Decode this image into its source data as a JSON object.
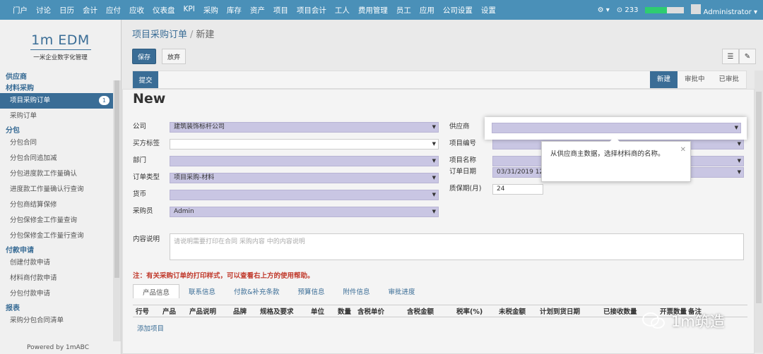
{
  "topnav": [
    "门户",
    "讨论",
    "日历",
    "会计",
    "应付",
    "应收",
    "仪表盘",
    "KPI",
    "采购",
    "库存",
    "资产",
    "项目",
    "项目会计",
    "工人",
    "费用管理",
    "员工",
    "应用",
    "公司设置",
    "设置"
  ],
  "topright": {
    "gear": "⚙ ▾",
    "notif": "233",
    "user": "Administrator ▾",
    "progress": 0.55
  },
  "logo": {
    "name": "1m EDM",
    "tagline": "一米企业数字化管理"
  },
  "sidebar": {
    "sections": [
      {
        "title": "供应商",
        "items": []
      },
      {
        "title": "材料采购",
        "items": [
          {
            "label": "项目采购订单",
            "badge": "1",
            "active": true
          },
          {
            "label": "采购订单"
          }
        ]
      },
      {
        "title": "分包",
        "items": [
          {
            "label": "分包合同"
          },
          {
            "label": "分包合同追加减"
          },
          {
            "label": "分包进度款工作量确认"
          },
          {
            "label": "进度款工作量确认行查询"
          },
          {
            "label": "分包商结算保修"
          },
          {
            "label": "分包保修金工作量查询"
          },
          {
            "label": "分包保修金工作量行查询"
          }
        ]
      },
      {
        "title": "付款申请",
        "items": [
          {
            "label": "创建付款申请"
          },
          {
            "label": "材料商付款申请"
          },
          {
            "label": "分包付款申请"
          }
        ]
      },
      {
        "title": "报表",
        "items": [
          {
            "label": "采购分包合同清单"
          }
        ]
      }
    ],
    "powered": "Powered by 1mABC"
  },
  "breadcrumb": {
    "parent": "项目采购订单",
    "current": "新建"
  },
  "buttons": {
    "save": "保存",
    "discard": "放弃",
    "submit": "提交"
  },
  "stages": [
    "新建",
    "审批中",
    "已审批"
  ],
  "form": {
    "title": "New",
    "left": [
      {
        "label": "公司",
        "value": "建筑装饰标杆公司"
      },
      {
        "label": "买方标签",
        "value": "",
        "white": true
      },
      {
        "label": "部门",
        "value": ""
      },
      {
        "label": "订单类型",
        "value": "项目采购-材料"
      },
      {
        "label": "货币",
        "value": ""
      },
      {
        "label": "采购员",
        "value": "Admin"
      }
    ],
    "right": [
      {
        "label": "供应商",
        "value": ""
      },
      {
        "label": "项目编号",
        "value": ""
      },
      {
        "label": "项目名称",
        "value": ""
      },
      {
        "label": "订单日期",
        "value": "03/31/2019 12"
      },
      {
        "label": "质保期(月)",
        "value": "24"
      }
    ],
    "desc_label": "内容说明",
    "desc_placeholder": "请说明需要打印在合同 采购内容 中的内容说明"
  },
  "note": "注：有关采购订单的打印样式，可以查看右上方的使用帮助。",
  "tabs": [
    "产品信息",
    "联系信息",
    "付款&补充条款",
    "预算信息",
    "附件信息",
    "审批进度"
  ],
  "table_headers": [
    "行号",
    "产品",
    "产品说明",
    "品牌",
    "规格及要求",
    "单位",
    "数量",
    "含税单价",
    "含税金额",
    "税率(%)",
    "未税金额",
    "计划到货日期",
    "已接收数量",
    "开票数量",
    "备注"
  ],
  "add_item": "添加项目",
  "tooltip": "从供应商主数据，选择材料商的名称。",
  "watermark": "1m筑造"
}
